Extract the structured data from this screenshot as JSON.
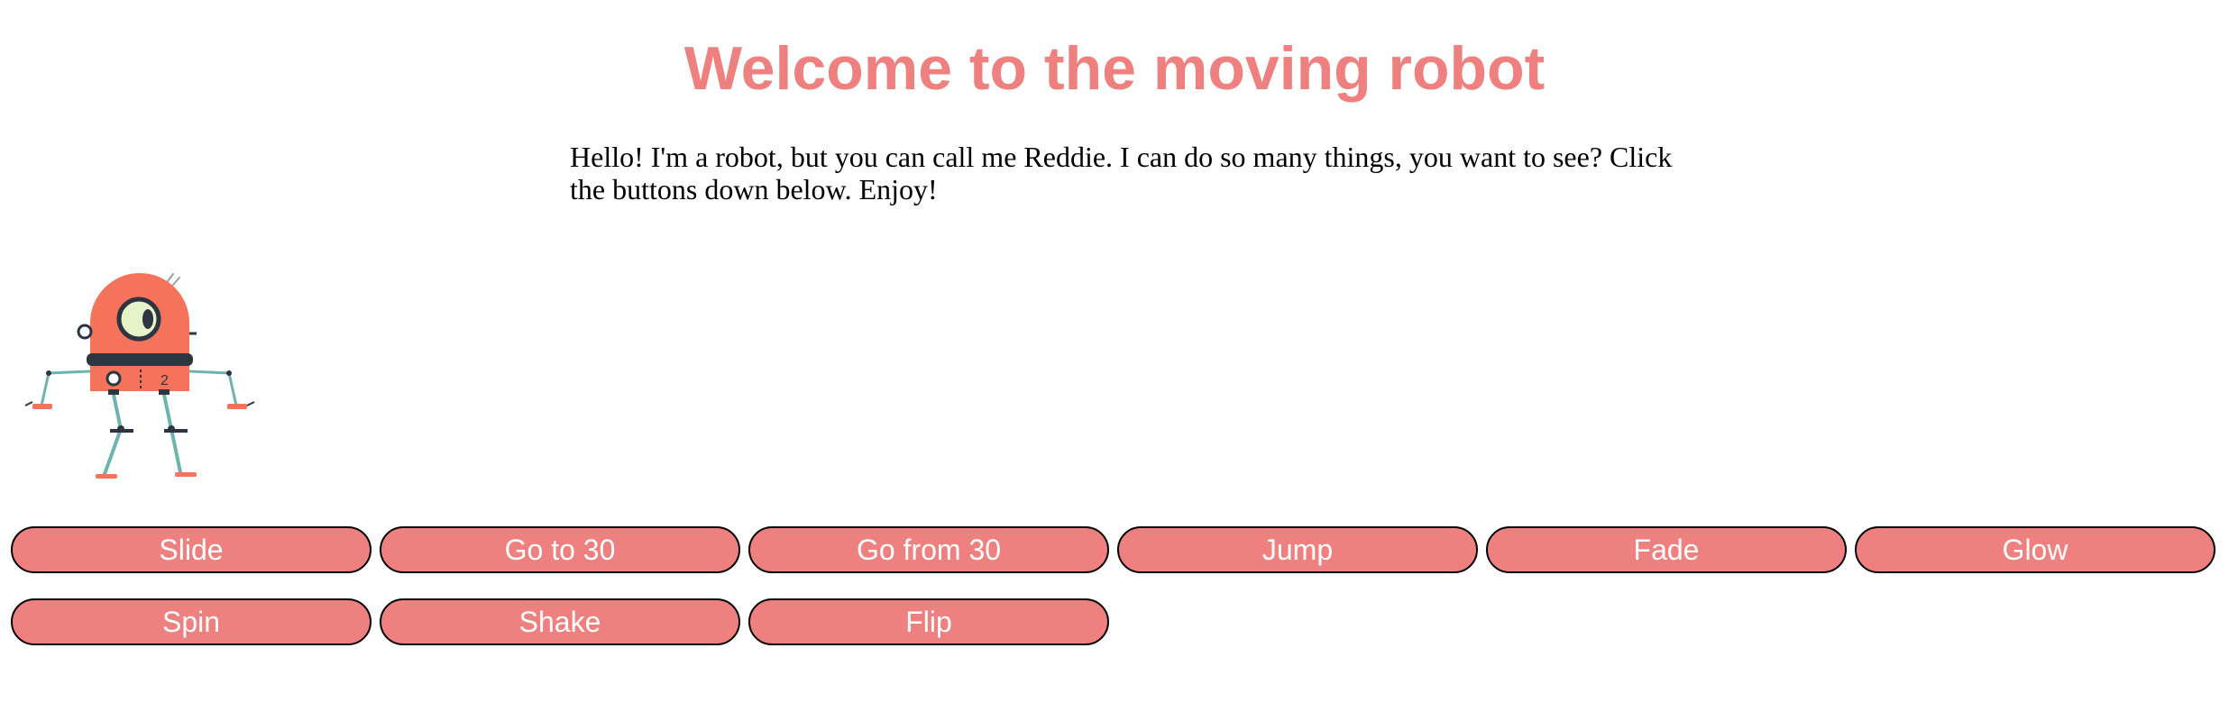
{
  "header": {
    "title": "Welcome to the moving robot"
  },
  "intro": {
    "text": "Hello! I'm a robot, but you can call me Reddie. I can do so many things, you want to see? Click the buttons down below. Enjoy!"
  },
  "robot": {
    "icon": "robot-icon",
    "badge": "2",
    "colors": {
      "body": "#f4735a",
      "limbs": "#6fb3b0",
      "eye": "#e6f2c8",
      "band": "#2d3540"
    }
  },
  "buttons": [
    {
      "label": "Slide"
    },
    {
      "label": "Go to 30"
    },
    {
      "label": "Go from 30"
    },
    {
      "label": "Jump"
    },
    {
      "label": "Fade"
    },
    {
      "label": "Glow"
    },
    {
      "label": "Spin"
    },
    {
      "label": "Shake"
    },
    {
      "label": "Flip"
    }
  ],
  "theme": {
    "accent": "#ef8080",
    "button_text": "#ffffff",
    "body_text": "#000000"
  }
}
